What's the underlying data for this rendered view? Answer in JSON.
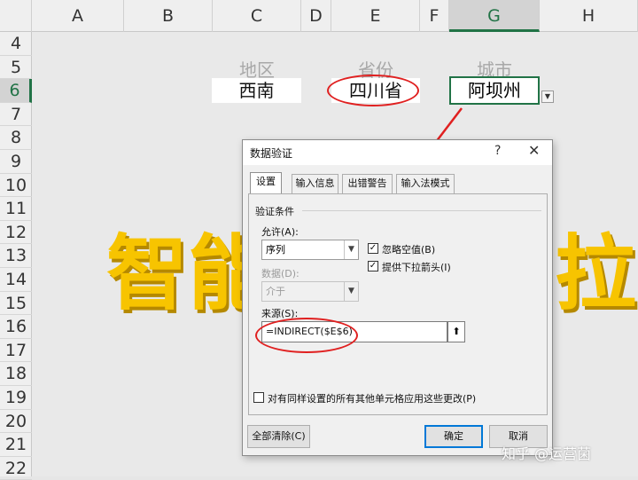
{
  "spreadsheet": {
    "columns": [
      {
        "label": "A"
      },
      {
        "label": "B"
      },
      {
        "label": "C"
      },
      {
        "label": "D"
      },
      {
        "label": "E"
      },
      {
        "label": "F"
      },
      {
        "label": "G"
      },
      {
        "label": "H"
      }
    ],
    "rows": [
      "4",
      "5",
      "6",
      "7",
      "8",
      "9",
      "10",
      "11",
      "12",
      "13",
      "14",
      "15",
      "16",
      "17",
      "18",
      "19",
      "20",
      "21",
      "22"
    ],
    "selected_column": "G",
    "selected_row": "6",
    "headers": {
      "region": "地区",
      "province": "省份",
      "city": "城市"
    },
    "values": {
      "region": "西南",
      "province": "四川省",
      "city": "阿坝州"
    },
    "banner_left": "智能",
    "banner_right": "拉"
  },
  "dialog": {
    "title": "数据验证",
    "help": "?",
    "close": "✕",
    "tabs": [
      {
        "label": "设置",
        "active": true
      },
      {
        "label": "输入信息",
        "active": false
      },
      {
        "label": "出错警告",
        "active": false
      },
      {
        "label": "输入法模式",
        "active": false
      }
    ],
    "section_title": "验证条件",
    "allow_label": "允许(A):",
    "allow_value": "序列",
    "ignore_blank": {
      "label": "忽略空值(B)",
      "checked": true
    },
    "dropdown_arrow": {
      "label": "提供下拉箭头(I)",
      "checked": true
    },
    "data_label": "数据(D):",
    "data_value": "介于",
    "source_label": "来源(S):",
    "source_value": "=INDIRECT($E$6)",
    "apply_all": {
      "label": "对有同样设置的所有其他单元格应用这些更改(P)",
      "checked": false
    },
    "clear_all": "全部清除(C)",
    "ok": "确定",
    "cancel": "取消"
  },
  "watermark": "知乎 @运营菌",
  "colors": {
    "accent": "#217346",
    "annotation": "#e02020",
    "banner": "#f7c400"
  }
}
